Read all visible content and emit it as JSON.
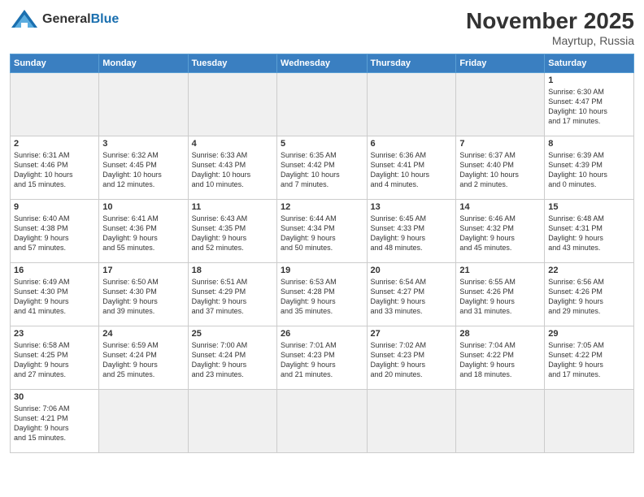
{
  "header": {
    "logo_general": "General",
    "logo_blue": "Blue",
    "month": "November 2025",
    "location": "Mayrtup, Russia"
  },
  "days_of_week": [
    "Sunday",
    "Monday",
    "Tuesday",
    "Wednesday",
    "Thursday",
    "Friday",
    "Saturday"
  ],
  "weeks": [
    [
      {
        "day": "",
        "empty": true
      },
      {
        "day": "",
        "empty": true
      },
      {
        "day": "",
        "empty": true
      },
      {
        "day": "",
        "empty": true
      },
      {
        "day": "",
        "empty": true
      },
      {
        "day": "",
        "empty": true
      },
      {
        "day": "1",
        "info": "Sunrise: 6:30 AM\nSunset: 4:47 PM\nDaylight: 10 hours\nand 17 minutes."
      }
    ],
    [
      {
        "day": "2",
        "info": "Sunrise: 6:31 AM\nSunset: 4:46 PM\nDaylight: 10 hours\nand 15 minutes."
      },
      {
        "day": "3",
        "info": "Sunrise: 6:32 AM\nSunset: 4:45 PM\nDaylight: 10 hours\nand 12 minutes."
      },
      {
        "day": "4",
        "info": "Sunrise: 6:33 AM\nSunset: 4:43 PM\nDaylight: 10 hours\nand 10 minutes."
      },
      {
        "day": "5",
        "info": "Sunrise: 6:35 AM\nSunset: 4:42 PM\nDaylight: 10 hours\nand 7 minutes."
      },
      {
        "day": "6",
        "info": "Sunrise: 6:36 AM\nSunset: 4:41 PM\nDaylight: 10 hours\nand 4 minutes."
      },
      {
        "day": "7",
        "info": "Sunrise: 6:37 AM\nSunset: 4:40 PM\nDaylight: 10 hours\nand 2 minutes."
      },
      {
        "day": "8",
        "info": "Sunrise: 6:39 AM\nSunset: 4:39 PM\nDaylight: 10 hours\nand 0 minutes."
      }
    ],
    [
      {
        "day": "9",
        "info": "Sunrise: 6:40 AM\nSunset: 4:38 PM\nDaylight: 9 hours\nand 57 minutes."
      },
      {
        "day": "10",
        "info": "Sunrise: 6:41 AM\nSunset: 4:36 PM\nDaylight: 9 hours\nand 55 minutes."
      },
      {
        "day": "11",
        "info": "Sunrise: 6:43 AM\nSunset: 4:35 PM\nDaylight: 9 hours\nand 52 minutes."
      },
      {
        "day": "12",
        "info": "Sunrise: 6:44 AM\nSunset: 4:34 PM\nDaylight: 9 hours\nand 50 minutes."
      },
      {
        "day": "13",
        "info": "Sunrise: 6:45 AM\nSunset: 4:33 PM\nDaylight: 9 hours\nand 48 minutes."
      },
      {
        "day": "14",
        "info": "Sunrise: 6:46 AM\nSunset: 4:32 PM\nDaylight: 9 hours\nand 45 minutes."
      },
      {
        "day": "15",
        "info": "Sunrise: 6:48 AM\nSunset: 4:31 PM\nDaylight: 9 hours\nand 43 minutes."
      }
    ],
    [
      {
        "day": "16",
        "info": "Sunrise: 6:49 AM\nSunset: 4:30 PM\nDaylight: 9 hours\nand 41 minutes."
      },
      {
        "day": "17",
        "info": "Sunrise: 6:50 AM\nSunset: 4:30 PM\nDaylight: 9 hours\nand 39 minutes."
      },
      {
        "day": "18",
        "info": "Sunrise: 6:51 AM\nSunset: 4:29 PM\nDaylight: 9 hours\nand 37 minutes."
      },
      {
        "day": "19",
        "info": "Sunrise: 6:53 AM\nSunset: 4:28 PM\nDaylight: 9 hours\nand 35 minutes."
      },
      {
        "day": "20",
        "info": "Sunrise: 6:54 AM\nSunset: 4:27 PM\nDaylight: 9 hours\nand 33 minutes."
      },
      {
        "day": "21",
        "info": "Sunrise: 6:55 AM\nSunset: 4:26 PM\nDaylight: 9 hours\nand 31 minutes."
      },
      {
        "day": "22",
        "info": "Sunrise: 6:56 AM\nSunset: 4:26 PM\nDaylight: 9 hours\nand 29 minutes."
      }
    ],
    [
      {
        "day": "23",
        "info": "Sunrise: 6:58 AM\nSunset: 4:25 PM\nDaylight: 9 hours\nand 27 minutes."
      },
      {
        "day": "24",
        "info": "Sunrise: 6:59 AM\nSunset: 4:24 PM\nDaylight: 9 hours\nand 25 minutes."
      },
      {
        "day": "25",
        "info": "Sunrise: 7:00 AM\nSunset: 4:24 PM\nDaylight: 9 hours\nand 23 minutes."
      },
      {
        "day": "26",
        "info": "Sunrise: 7:01 AM\nSunset: 4:23 PM\nDaylight: 9 hours\nand 21 minutes."
      },
      {
        "day": "27",
        "info": "Sunrise: 7:02 AM\nSunset: 4:23 PM\nDaylight: 9 hours\nand 20 minutes."
      },
      {
        "day": "28",
        "info": "Sunrise: 7:04 AM\nSunset: 4:22 PM\nDaylight: 9 hours\nand 18 minutes."
      },
      {
        "day": "29",
        "info": "Sunrise: 7:05 AM\nSunset: 4:22 PM\nDaylight: 9 hours\nand 17 minutes."
      }
    ],
    [
      {
        "day": "30",
        "info": "Sunrise: 7:06 AM\nSunset: 4:21 PM\nDaylight: 9 hours\nand 15 minutes."
      },
      {
        "day": "",
        "empty": true
      },
      {
        "day": "",
        "empty": true
      },
      {
        "day": "",
        "empty": true
      },
      {
        "day": "",
        "empty": true
      },
      {
        "day": "",
        "empty": true
      },
      {
        "day": "",
        "empty": true
      }
    ]
  ]
}
